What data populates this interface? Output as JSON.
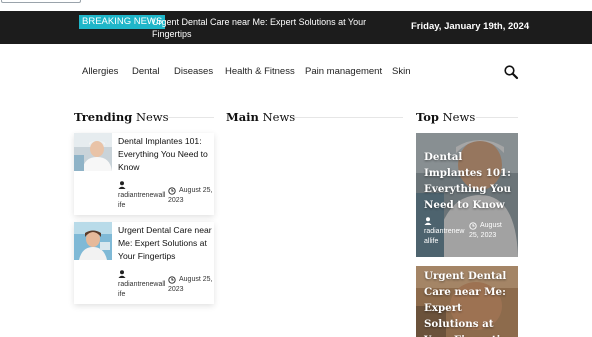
{
  "ticker": {
    "badge": "BREAKING NEWS",
    "headline": "Urgent Dental Care near Me: Expert Solutions at Your Fingertips",
    "date": "Friday, January 19th, 2024"
  },
  "nav": {
    "items": [
      "Allergies",
      "Dental",
      "Diseases",
      "Health & Fitness",
      "Pain management",
      "Skin"
    ]
  },
  "sections": {
    "trending": {
      "strong": "Trending",
      "light": "News"
    },
    "main": {
      "strong": "Main",
      "light": "News"
    },
    "top": {
      "strong": "Top",
      "light": "News"
    }
  },
  "trending_posts": [
    {
      "title": "Dental Implantes 101: Everything You Need to Know",
      "author": "radiantrenewallife",
      "date_line1": "August 25,",
      "date_line2": "2023"
    },
    {
      "title": "Urgent Dental Care near Me: Expert Solutions at Your Fingertips",
      "author": "radiantrenewallife",
      "date_line1": "August 25,",
      "date_line2": "2023"
    }
  ],
  "top_posts": [
    {
      "title": "Dental Implantes 101: Everything You Need to Know",
      "author": "radiantrenewallife",
      "date_line1": "August",
      "date_line2": "25, 2023"
    },
    {
      "title": "Urgent Dental Care near Me: Expert Solutions at Your Fingertips"
    }
  ],
  "colors": {
    "accent": "#1fb6c9",
    "ticker_bg": "#1c1c1c"
  },
  "icons": {
    "search": "search-icon",
    "author": "user-icon",
    "date": "clock-icon"
  }
}
